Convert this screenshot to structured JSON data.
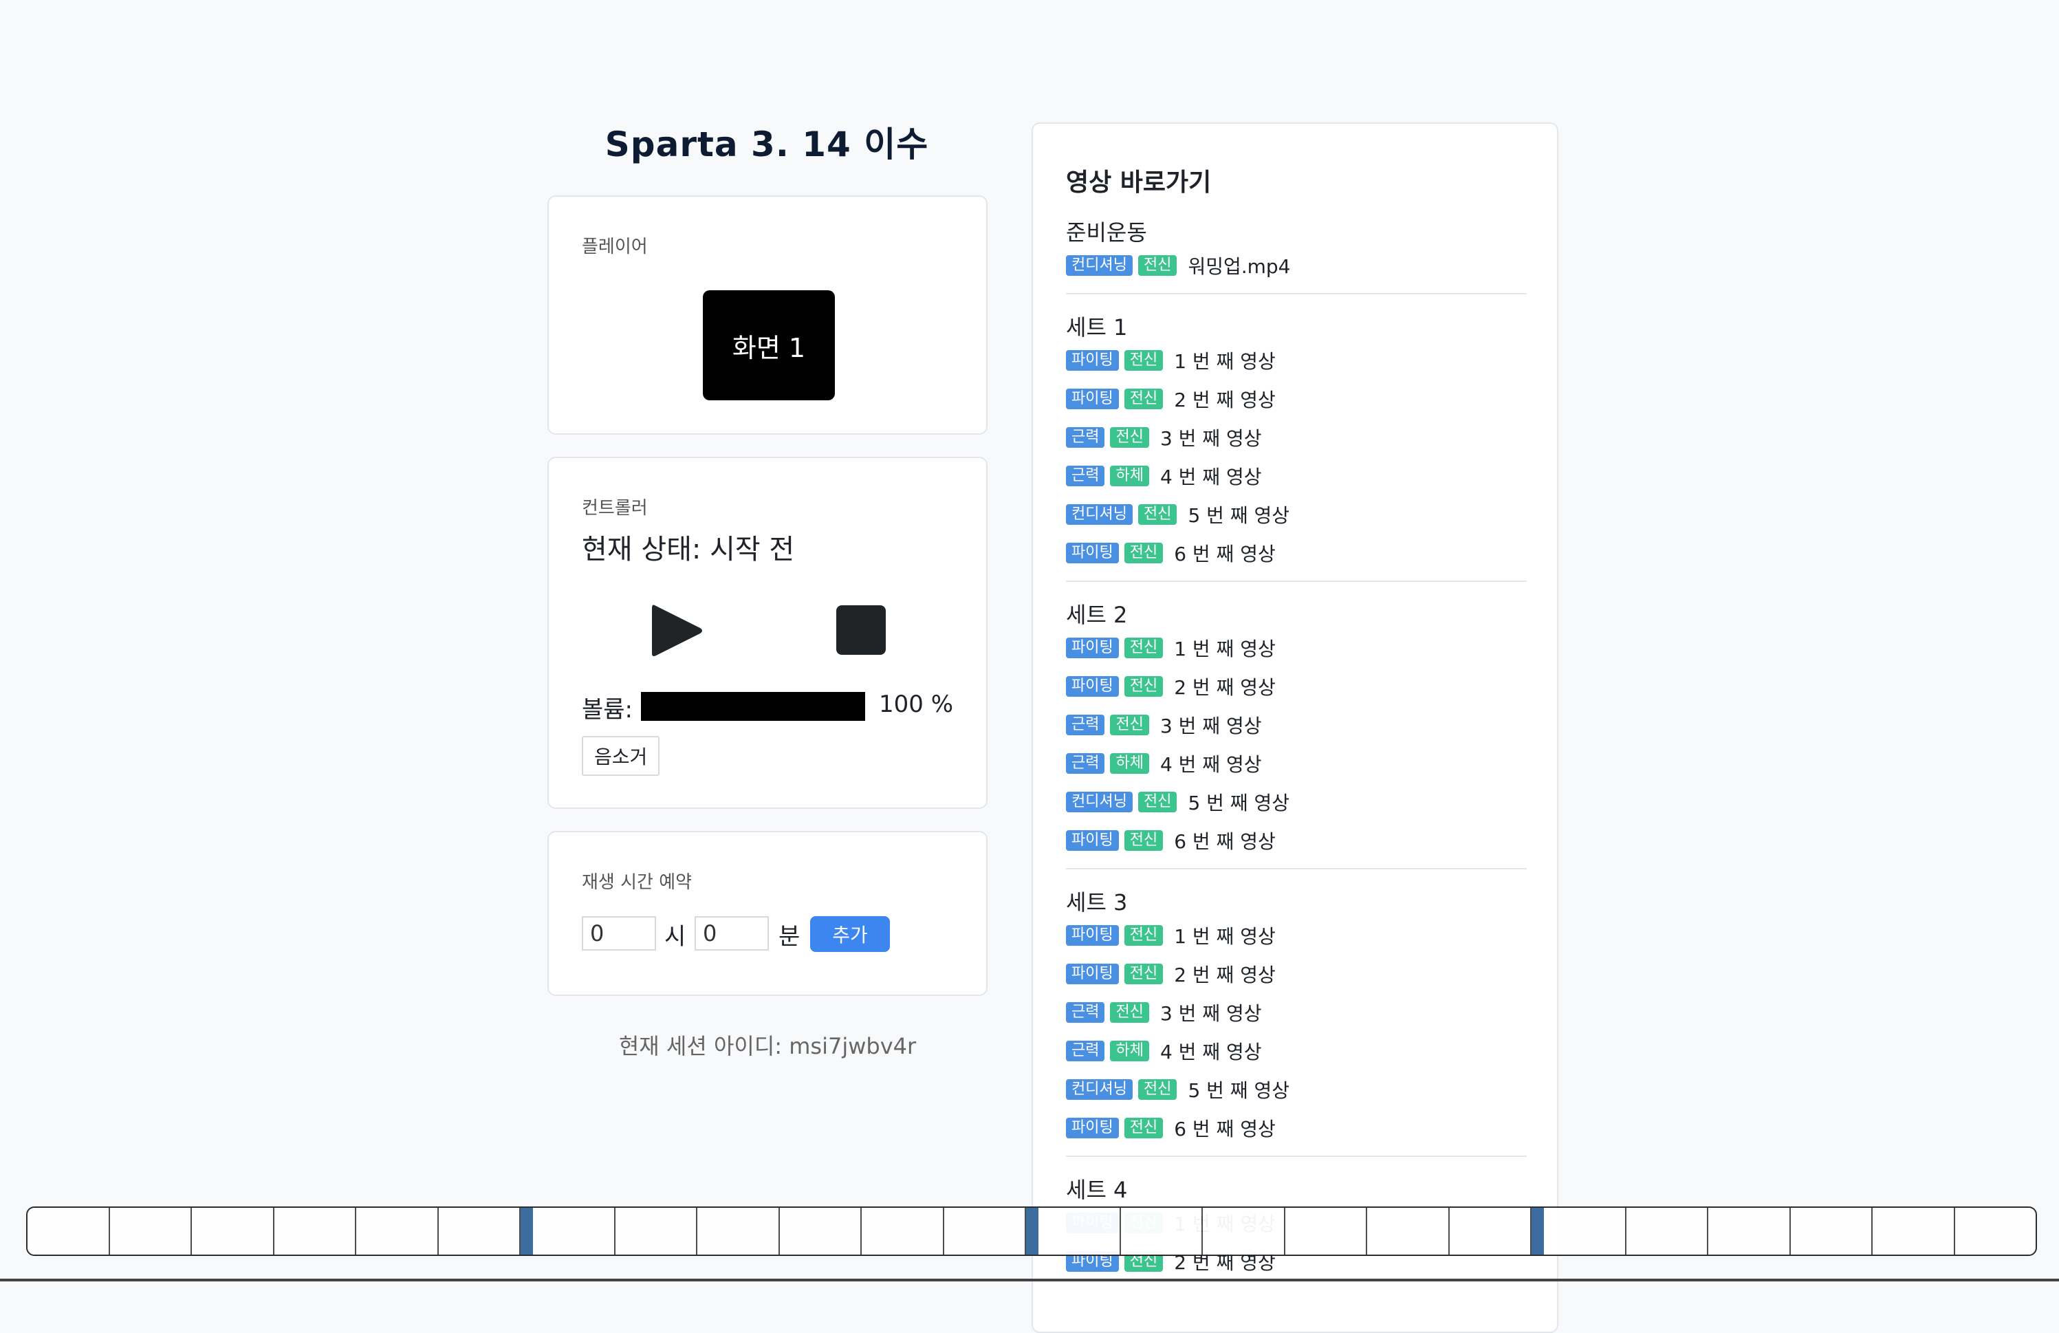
{
  "title": "Sparta 3. 14 이수",
  "player": {
    "label": "플레이어",
    "screen": "화면 1"
  },
  "controller": {
    "label": "컨트롤러",
    "status": "현재 상태: 시작 전",
    "volume_label": "볼륨:",
    "volume_value": "100 %",
    "volume_level": 1.0,
    "mute_label": "음소거"
  },
  "schedule": {
    "label": "재생 시간 예약",
    "hour_value": "0",
    "hour_unit": "시",
    "minute_value": "0",
    "minute_unit": "분",
    "add_label": "추가"
  },
  "session": "현재 세션 아이디: msi7jwbv4r",
  "videos": {
    "heading": "영상 바로가기",
    "sets": [
      {
        "title": "준비운동",
        "items": [
          {
            "type": "컨디셔닝",
            "area": "전신",
            "label": "워밍업.mp4"
          }
        ]
      },
      {
        "title": "세트 1",
        "items": [
          {
            "type": "파이팅",
            "area": "전신",
            "label": "1 번 째 영상"
          },
          {
            "type": "파이팅",
            "area": "전신",
            "label": "2 번 째 영상"
          },
          {
            "type": "근력",
            "area": "전신",
            "label": "3 번 째 영상"
          },
          {
            "type": "근력",
            "area": "하체",
            "label": "4 번 째 영상"
          },
          {
            "type": "컨디셔닝",
            "area": "전신",
            "label": "5 번 째 영상"
          },
          {
            "type": "파이팅",
            "area": "전신",
            "label": "6 번 째 영상"
          }
        ]
      },
      {
        "title": "세트 2",
        "items": [
          {
            "type": "파이팅",
            "area": "전신",
            "label": "1 번 째 영상"
          },
          {
            "type": "파이팅",
            "area": "전신",
            "label": "2 번 째 영상"
          },
          {
            "type": "근력",
            "area": "전신",
            "label": "3 번 째 영상"
          },
          {
            "type": "근력",
            "area": "하체",
            "label": "4 번 째 영상"
          },
          {
            "type": "컨디셔닝",
            "area": "전신",
            "label": "5 번 째 영상"
          },
          {
            "type": "파이팅",
            "area": "전신",
            "label": "6 번 째 영상"
          }
        ]
      },
      {
        "title": "세트 3",
        "items": [
          {
            "type": "파이팅",
            "area": "전신",
            "label": "1 번 째 영상"
          },
          {
            "type": "파이팅",
            "area": "전신",
            "label": "2 번 째 영상"
          },
          {
            "type": "근력",
            "area": "전신",
            "label": "3 번 째 영상"
          },
          {
            "type": "근력",
            "area": "하체",
            "label": "4 번 째 영상"
          },
          {
            "type": "컨디셔닝",
            "area": "전신",
            "label": "5 번 째 영상"
          },
          {
            "type": "파이팅",
            "area": "전신",
            "label": "6 번 째 영상"
          }
        ]
      },
      {
        "title": "세트 4",
        "items": [
          {
            "type": "파이팅",
            "area": "전신",
            "label": "1 번 째 영상"
          },
          {
            "type": "파이팅",
            "area": "전신",
            "label": "2 번 째 영상"
          }
        ]
      }
    ]
  },
  "colors": {
    "accent": "#3d86f0",
    "tag_type": "#4a90e2",
    "tag_area": "#3cc48f"
  },
  "icons": {
    "play": "play-icon",
    "stop": "stop-icon"
  }
}
